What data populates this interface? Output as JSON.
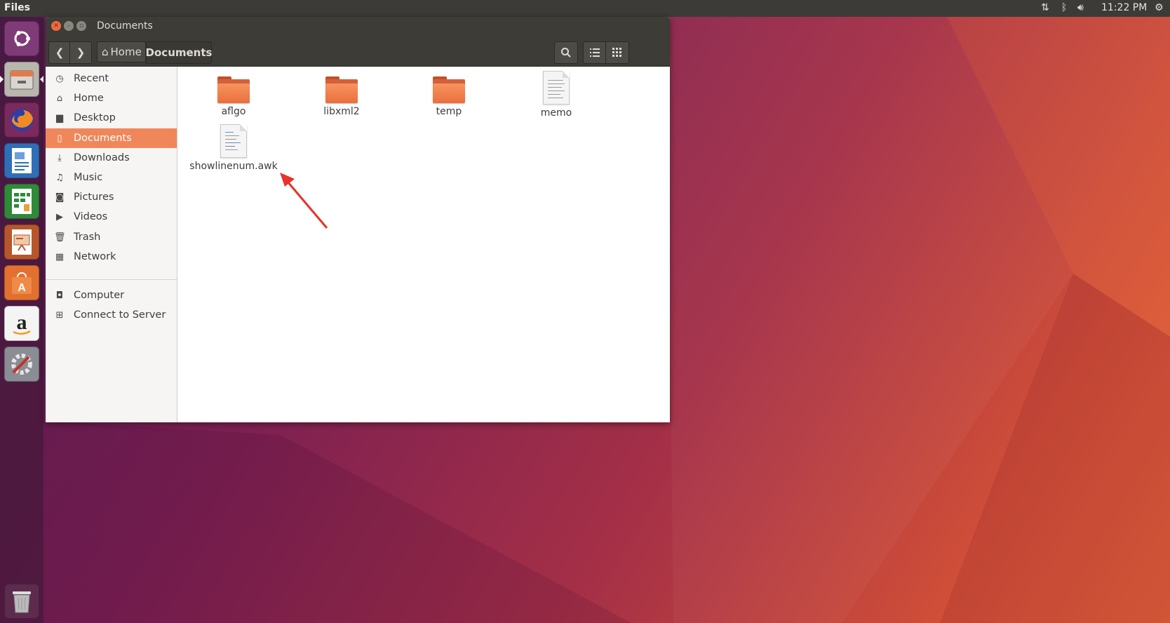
{
  "top_panel": {
    "app_name": "Files",
    "clock": "11:22 PM",
    "indicators": [
      "network-icon",
      "bluetooth-icon",
      "volume-icon",
      "power-gear-icon"
    ]
  },
  "launcher": {
    "items": [
      {
        "name": "ubuntu-dash",
        "icon": "ubuntu-logo-icon",
        "color": "#7f3a78"
      },
      {
        "name": "files",
        "icon": "file-cabinet-icon",
        "color": "#b9b6ae",
        "active": true
      },
      {
        "name": "firefox",
        "icon": "firefox-icon",
        "color": "#e56a26"
      },
      {
        "name": "libreoffice-writer",
        "icon": "writer-doc-icon",
        "color": "#2f6fb8"
      },
      {
        "name": "libreoffice-calc",
        "icon": "calc-sheet-icon",
        "color": "#2f8a3a"
      },
      {
        "name": "libreoffice-impress",
        "icon": "impress-slides-icon",
        "color": "#b8562b"
      },
      {
        "name": "software-center",
        "icon": "software-bag-icon",
        "color": "#e2702f"
      },
      {
        "name": "amazon",
        "icon": "amazon-a-icon",
        "color": "#f4f4f4"
      },
      {
        "name": "system-settings",
        "icon": "settings-tools-icon",
        "color": "#8a8d94"
      },
      {
        "name": "trash",
        "icon": "trash-can-icon",
        "color": "#9a9a9a"
      }
    ]
  },
  "window": {
    "title": "Documents",
    "breadcrumb": {
      "home": "Home",
      "current": "Documents"
    }
  },
  "sidebar": {
    "places": [
      {
        "label": "Recent",
        "icon": "clock-icon"
      },
      {
        "label": "Home",
        "icon": "home-icon"
      },
      {
        "label": "Desktop",
        "icon": "folder-icon"
      },
      {
        "label": "Documents",
        "icon": "document-icon",
        "active": true
      },
      {
        "label": "Downloads",
        "icon": "download-icon"
      },
      {
        "label": "Music",
        "icon": "music-note-icon"
      },
      {
        "label": "Pictures",
        "icon": "camera-icon"
      },
      {
        "label": "Videos",
        "icon": "film-icon"
      },
      {
        "label": "Trash",
        "icon": "trash-icon"
      },
      {
        "label": "Network",
        "icon": "network-icon"
      }
    ],
    "devices": [
      {
        "label": "Computer",
        "icon": "computer-icon"
      },
      {
        "label": "Connect to Server",
        "icon": "server-icon"
      }
    ]
  },
  "files": [
    {
      "name": "aflgo",
      "type": "folder"
    },
    {
      "name": "libxml2",
      "type": "folder"
    },
    {
      "name": "temp",
      "type": "folder"
    },
    {
      "name": "memo",
      "type": "text"
    },
    {
      "name": "showlinenum.awk",
      "type": "script"
    }
  ],
  "colors": {
    "accent": "#f0875a",
    "annotation_arrow": "#e8322a"
  }
}
